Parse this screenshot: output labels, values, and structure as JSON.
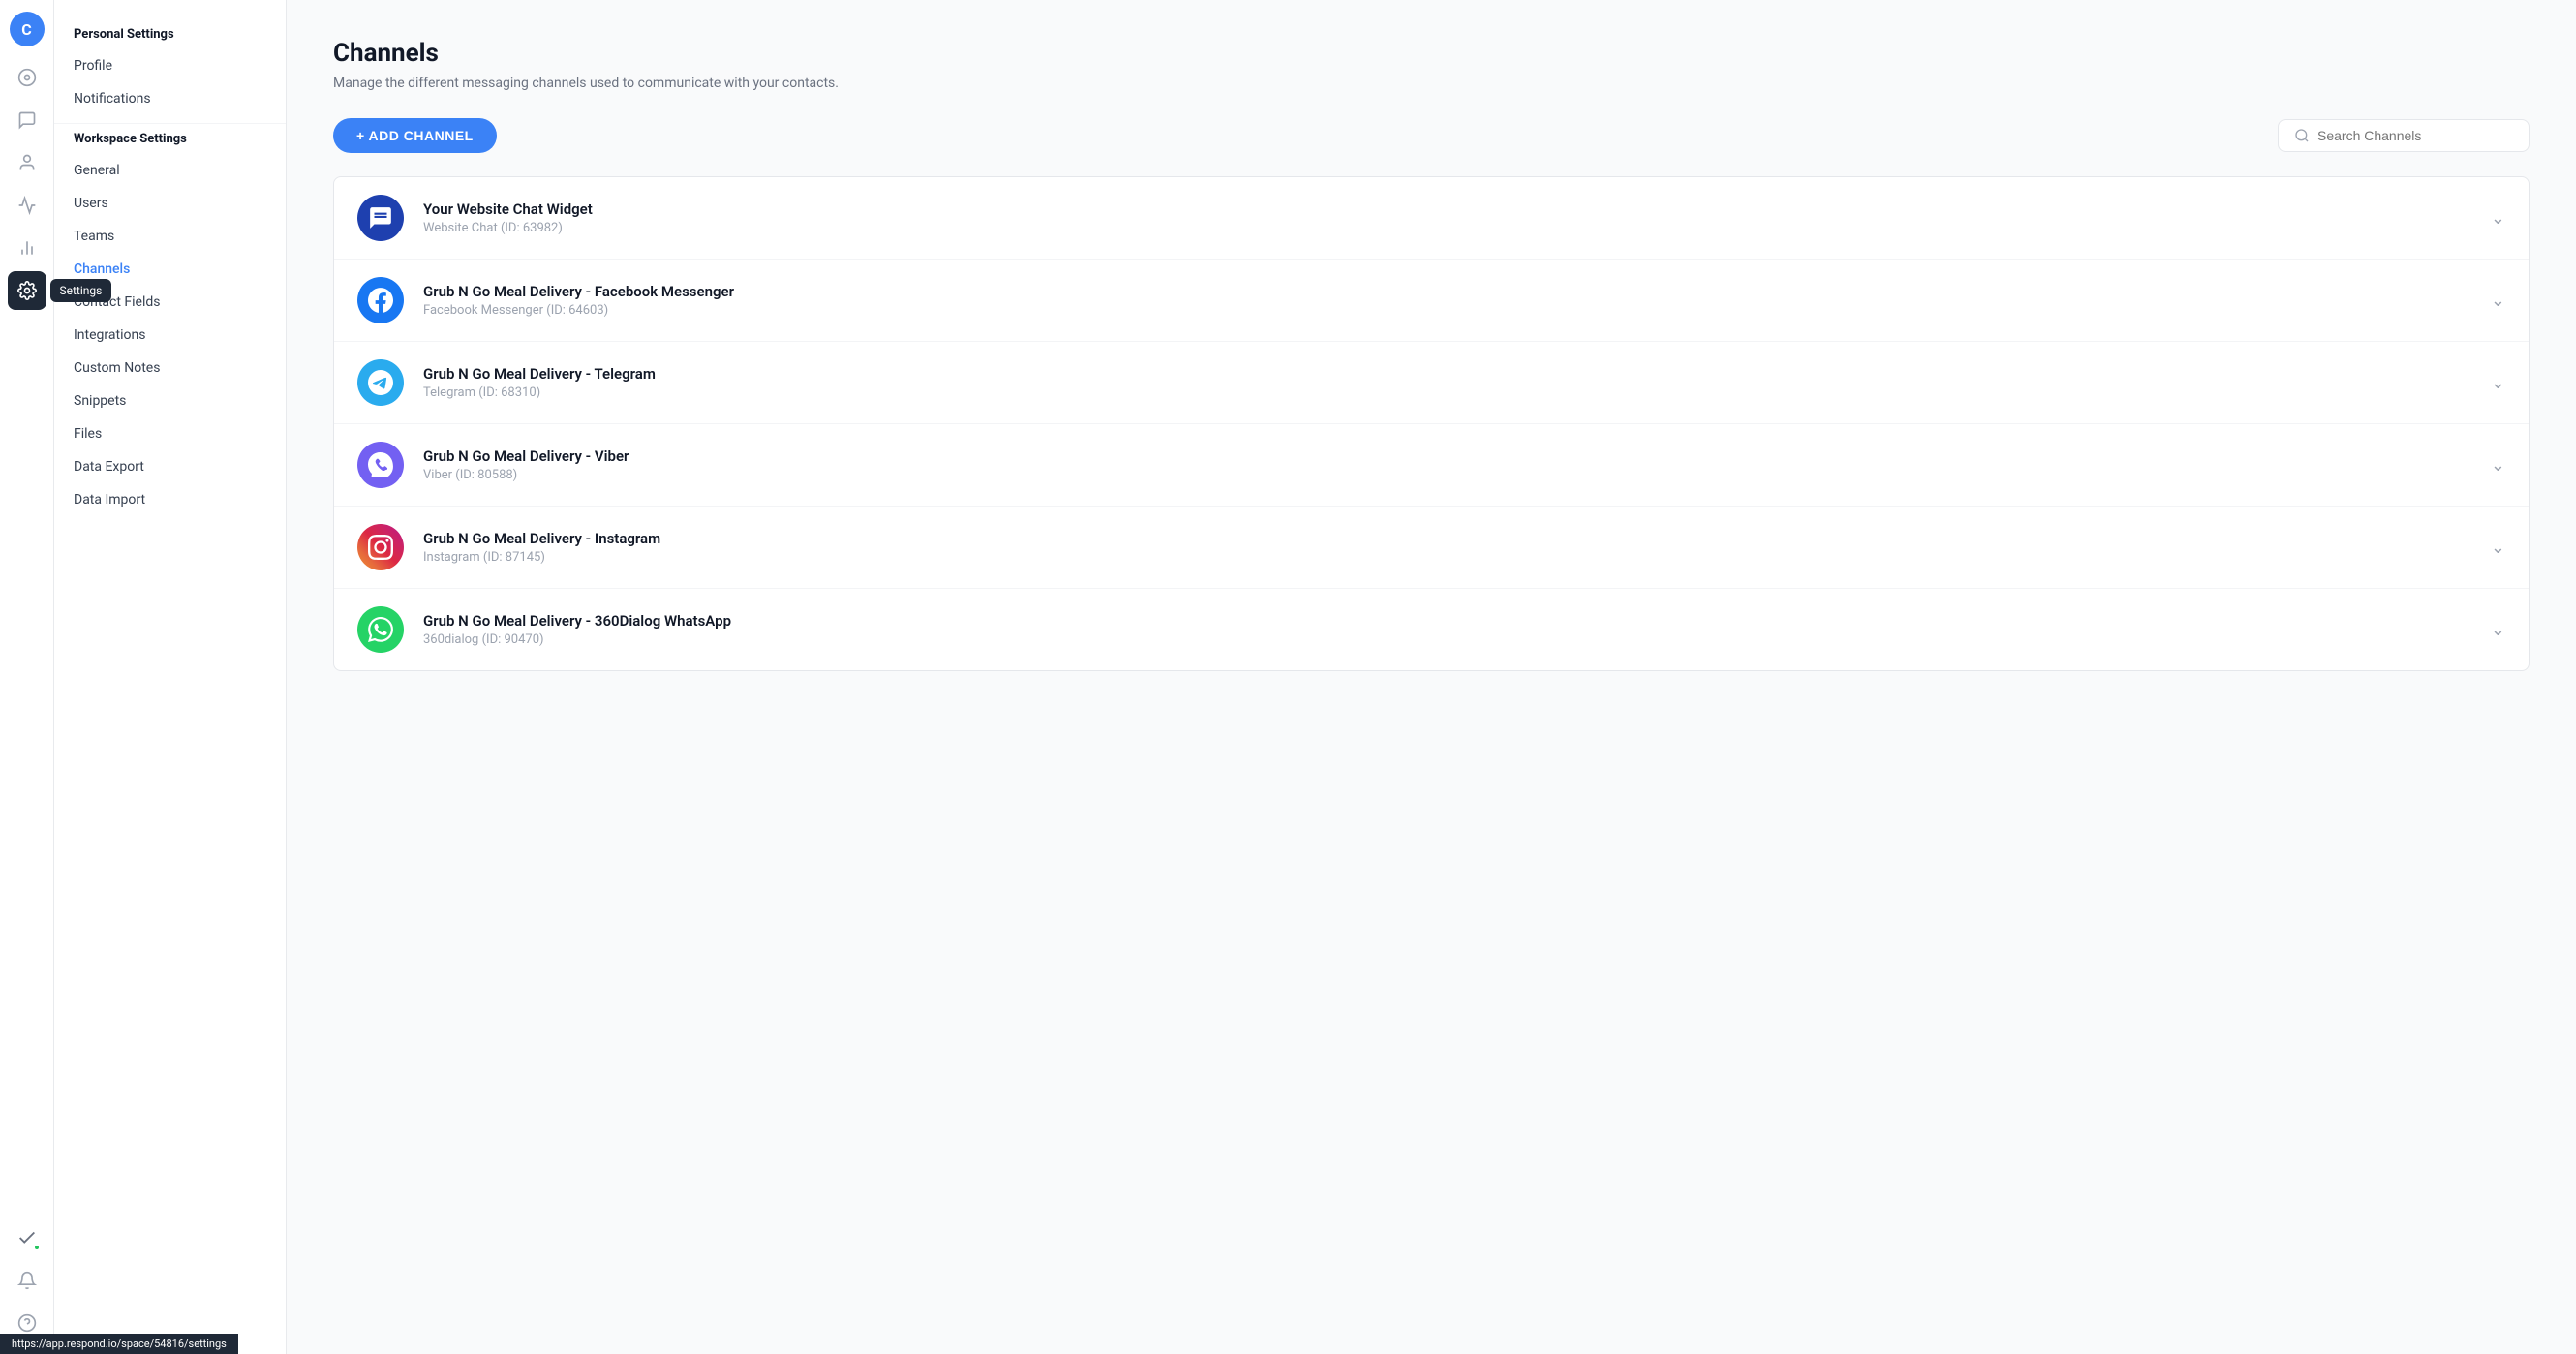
{
  "app": {
    "avatar_letter": "C",
    "url_bar": "https://app.respond.io/space/54816/settings"
  },
  "icon_bar": {
    "items": [
      {
        "name": "dashboard-icon",
        "symbol": "⊙",
        "active": false
      },
      {
        "name": "conversations-icon",
        "symbol": "💬",
        "active": false
      },
      {
        "name": "contacts-icon",
        "symbol": "👤",
        "active": false
      },
      {
        "name": "broadcasts-icon",
        "symbol": "📡",
        "active": false
      },
      {
        "name": "reports-icon",
        "symbol": "📊",
        "active": false
      },
      {
        "name": "settings-icon",
        "symbol": "⚙",
        "active": true,
        "has_tooltip": true,
        "tooltip": "Settings"
      }
    ],
    "bottom_items": [
      {
        "name": "integrations-icon",
        "symbol": "✔",
        "has_badge": true
      },
      {
        "name": "notifications-icon",
        "symbol": "🔔"
      },
      {
        "name": "help-icon",
        "symbol": "?"
      }
    ]
  },
  "sidebar": {
    "personal_settings_label": "Personal Settings",
    "profile_label": "Profile",
    "notifications_label": "Notifications",
    "workspace_settings_label": "Workspace Settings",
    "general_label": "General",
    "users_label": "Users",
    "teams_label": "Teams",
    "channels_label": "Channels",
    "contact_fields_label": "Contact Fields",
    "integrations_label": "Integrations",
    "custom_notes_label": "Custom Notes",
    "snippets_label": "Snippets",
    "files_label": "Files",
    "data_export_label": "Data Export",
    "data_import_label": "Data Import"
  },
  "main": {
    "title": "Channels",
    "subtitle": "Manage the different messaging channels used to communicate with your contacts.",
    "add_channel_label": "+ ADD CHANNEL",
    "search_placeholder": "Search Channels",
    "channels": [
      {
        "name": "Your Website Chat Widget",
        "sub": "Website Chat (ID: 63982)",
        "type": "webchat"
      },
      {
        "name": "Grub N Go Meal Delivery - Facebook Messenger",
        "sub": "Facebook Messenger (ID: 64603)",
        "type": "facebook"
      },
      {
        "name": "Grub N Go Meal Delivery - Telegram",
        "sub": "Telegram (ID: 68310)",
        "type": "telegram"
      },
      {
        "name": "Grub N Go Meal Delivery - Viber",
        "sub": "Viber (ID: 80588)",
        "type": "viber"
      },
      {
        "name": "Grub N Go Meal Delivery - Instagram",
        "sub": "Instagram (ID: 87145)",
        "type": "instagram"
      },
      {
        "name": "Grub N Go Meal Delivery - 360Dialog WhatsApp",
        "sub": "360dialog (ID: 90470)",
        "type": "whatsapp"
      }
    ]
  }
}
